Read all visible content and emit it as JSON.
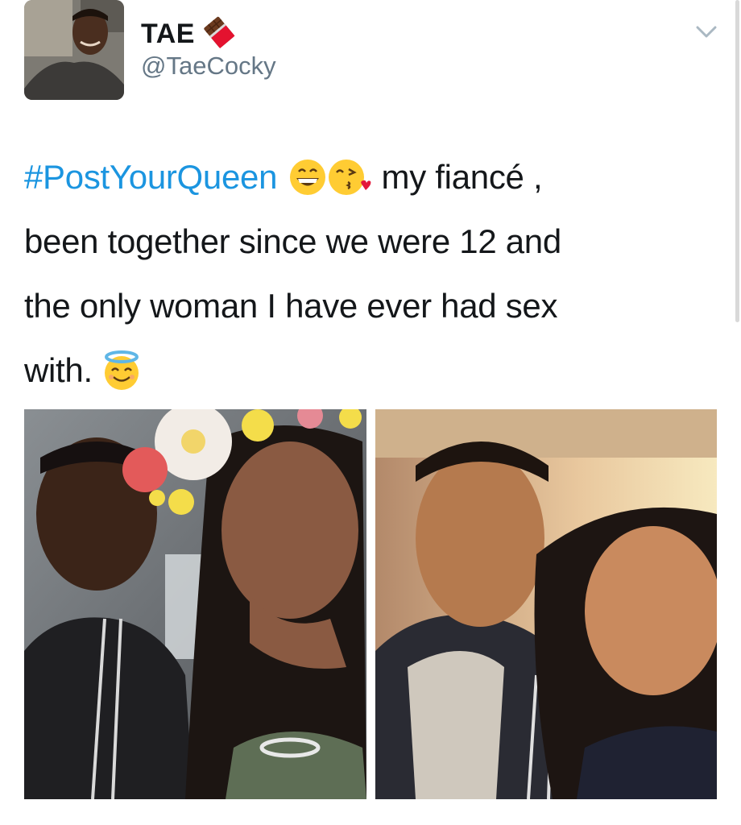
{
  "author": {
    "display_name": "TAE",
    "handle": "@TaeCocky",
    "name_emoji": "chocolate-bar-icon"
  },
  "tweet": {
    "hashtag": "#PostYourQueen",
    "line1_text": " my fiancé ,",
    "line2": "been together since we were 12 and",
    "line3": "the only woman I have ever had sex",
    "line4_text": "with. ",
    "emojis": [
      "grinning-face-icon",
      "face-blowing-kiss-icon",
      "smiling-face-with-halo-icon"
    ]
  },
  "media": {
    "photos": [
      "couple-selfie-flower-crown",
      "couple-selfie-car"
    ]
  },
  "colors": {
    "hashtag": "#1b95e0",
    "text": "#14171a",
    "secondary": "#657786",
    "caret": "#aab8c2"
  }
}
